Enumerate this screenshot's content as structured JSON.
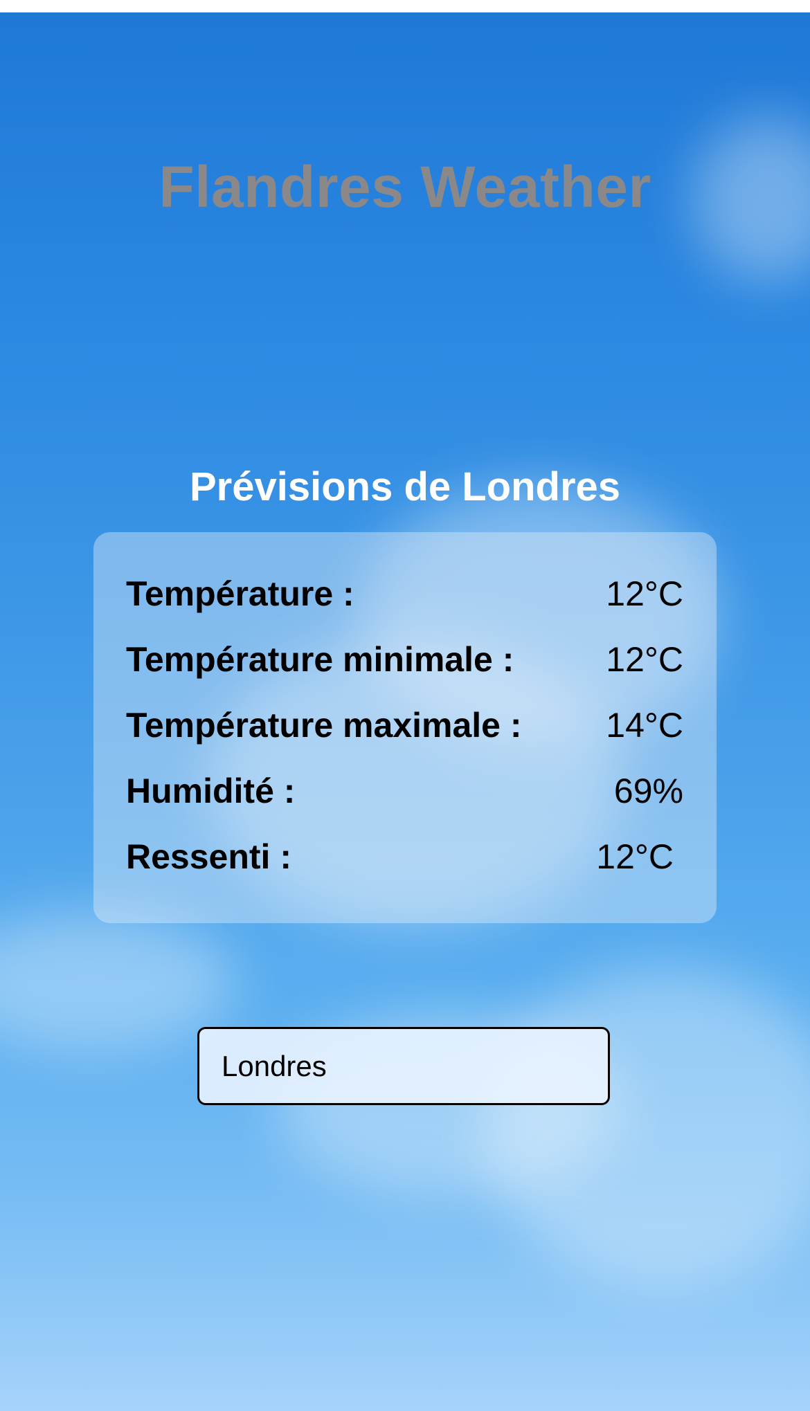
{
  "app": {
    "title": "Flandres Weather"
  },
  "forecast": {
    "heading": "Prévisions de Londres",
    "rows": [
      {
        "label": "Température :",
        "value": "12°C"
      },
      {
        "label": "Température minimale :",
        "value": "12°C"
      },
      {
        "label": "Température maximale :",
        "value": "14°C"
      },
      {
        "label": "Humidité :",
        "value": "69%"
      },
      {
        "label": "Ressenti :",
        "value": "12°C"
      }
    ]
  },
  "search": {
    "value": "Londres"
  },
  "colors": {
    "title": "#8a8888",
    "heading": "#ffffff",
    "sky_top": "#1f78d6",
    "sky_bottom": "#a6d3fa"
  }
}
